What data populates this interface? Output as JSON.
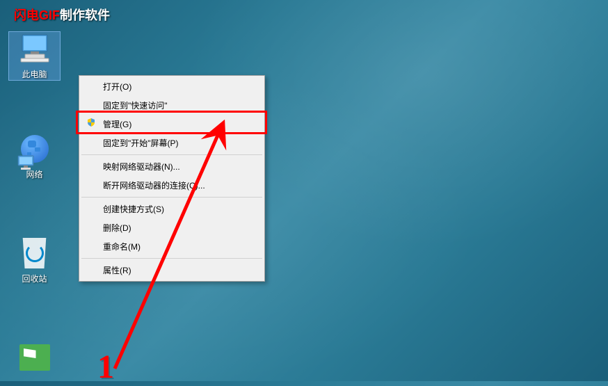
{
  "watermark": {
    "part1": "闪电GIF",
    "part2": "制作软件"
  },
  "desktop_icons": {
    "computer": "此电脑",
    "network": "网络",
    "recycle": "回收站"
  },
  "context_menu": {
    "open": "打开(O)",
    "pin_quick": "固定到\"快速访问\"",
    "manage": "管理(G)",
    "pin_start": "固定到\"开始\"屏幕(P)",
    "map_drive": "映射网络驱动器(N)...",
    "disconnect_drive": "断开网络驱动器的连接(C)...",
    "create_shortcut": "创建快捷方式(S)",
    "delete": "删除(D)",
    "rename": "重命名(M)",
    "properties": "属性(R)"
  },
  "annotation": {
    "number": "1"
  }
}
